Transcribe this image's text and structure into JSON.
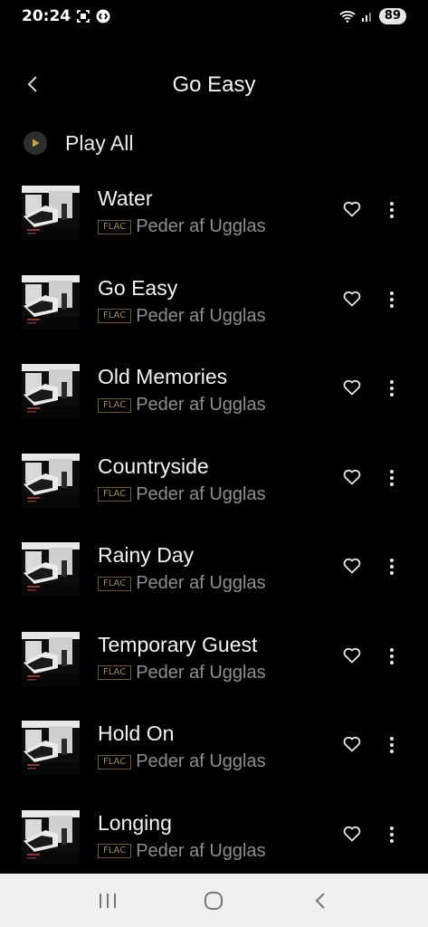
{
  "status_bar": {
    "time": "20:24",
    "battery": "89",
    "icons": [
      "screenshot-icon",
      "shazam-icon",
      "wifi-icon",
      "signal-icon"
    ]
  },
  "header": {
    "title": "Go Easy",
    "back_icon": "back-arrow-icon"
  },
  "play_all": {
    "label": "Play All",
    "icon": "play-icon"
  },
  "tracks": [
    {
      "title": "Water",
      "format": "FLAC",
      "artist": "Peder af Ugglas"
    },
    {
      "title": "Go Easy",
      "format": "FLAC",
      "artist": "Peder af Ugglas"
    },
    {
      "title": "Old Memories",
      "format": "FLAC",
      "artist": "Peder af Ugglas"
    },
    {
      "title": "Countryside",
      "format": "FLAC",
      "artist": "Peder af Ugglas"
    },
    {
      "title": "Rainy Day",
      "format": "FLAC",
      "artist": "Peder af Ugglas"
    },
    {
      "title": "Temporary Guest",
      "format": "FLAC",
      "artist": "Peder af Ugglas"
    },
    {
      "title": "Hold On",
      "format": "FLAC",
      "artist": "Peder af Ugglas"
    },
    {
      "title": "Longing",
      "format": "FLAC",
      "artist": "Peder af Ugglas"
    }
  ],
  "nav_bar": {
    "icons": [
      "recents-icon",
      "home-icon",
      "back-icon"
    ]
  },
  "colors": {
    "background": "#000000",
    "flac_badge": "#a08a60",
    "artist_text": "#8e8e8e",
    "nav_bar_bg": "#f0f0f0"
  }
}
